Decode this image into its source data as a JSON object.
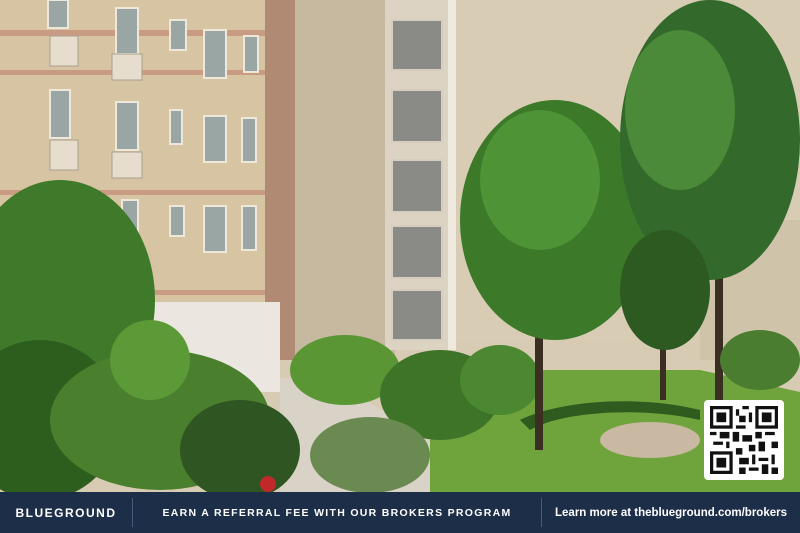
{
  "banner": {
    "brand": "BLUEGROUND",
    "promo": "EARN A REFERRAL FEE WITH OUR BROKERS PROGRAM",
    "cta": "Learn more at theblueground.com/brokers"
  },
  "qr": {
    "label": "qr-code"
  },
  "colors": {
    "banner_bg": "#1c2e48",
    "banner_text": "#ffffff",
    "divider": "#49597a"
  }
}
